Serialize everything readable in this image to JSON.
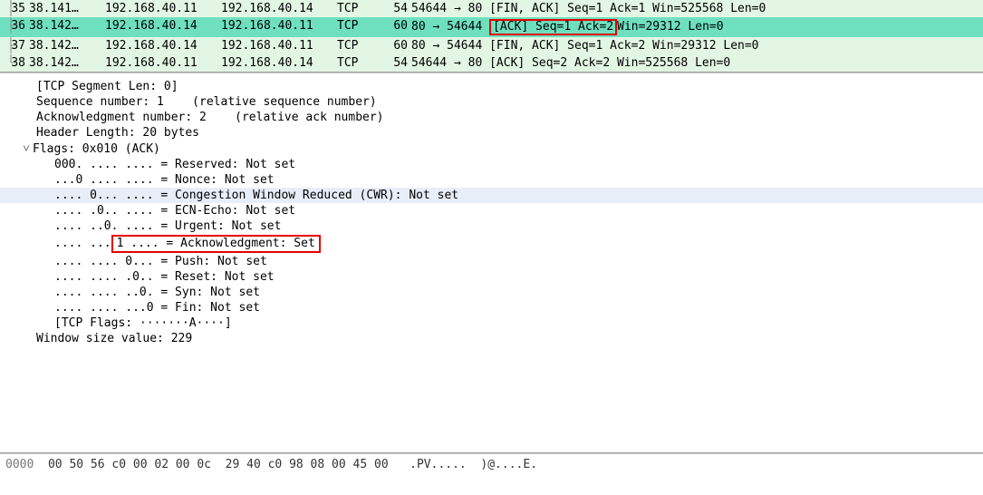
{
  "packets": [
    {
      "no": "35",
      "time": "38.141…",
      "src": "192.168.40.11",
      "dst": "192.168.40.14",
      "proto": "TCP",
      "len": "54",
      "info_pre": "54644 → 80 [FIN, ACK] Seq=1 Ack=1 Win=525568 Len=0",
      "cls": "green",
      "hl_text": "",
      "hl_post": ""
    },
    {
      "no": "36",
      "time": "38.142…",
      "src": "192.168.40.14",
      "dst": "192.168.40.11",
      "proto": "TCP",
      "len": "60",
      "info_pre": "80 → 54644 ",
      "hl_text": "[ACK] Seq=1 Ack=2 ",
      "hl_post": "Win=29312 Len=0",
      "cls": "teal"
    },
    {
      "no": "37",
      "time": "38.142…",
      "src": "192.168.40.14",
      "dst": "192.168.40.11",
      "proto": "TCP",
      "len": "60",
      "info_pre": "80 → 54644 [FIN, ACK] Seq=1 Ack=2 Win=29312 Len=0",
      "cls": "green",
      "hl_text": "",
      "hl_post": ""
    },
    {
      "no": "38",
      "time": "38.142…",
      "src": "192.168.40.11",
      "dst": "192.168.40.14",
      "proto": "TCP",
      "len": "54",
      "info_pre": "54644 → 80 [ACK] Seq=2 Ack=2 Win=525568 Len=0",
      "cls": "green",
      "hl_text": "",
      "hl_post": ""
    }
  ],
  "details": {
    "seg_len": "[TCP Segment Len: 0]",
    "seq": "Sequence number: 1    (relative sequence number)",
    "ackno": "Acknowledgment number: 2    (relative ack number)",
    "hlen": "Header Length: 20 bytes",
    "flags_hdr": "Flags: 0x010 (ACK)",
    "f_reserved": "000. .... .... = Reserved: Not set",
    "f_nonce": "...0 .... .... = Nonce: Not set",
    "f_cwr": ".... 0... .... = Congestion Window Reduced (CWR): Not set",
    "f_ecn": ".... .0.. .... = ECN-Echo: Not set",
    "f_urg": ".... ..0. .... = Urgent: Not set",
    "f_ack_pre": ".... ...",
    "f_ack_box": "1 .... = Acknowledgment: Set",
    "f_push": ".... .... 0... = Push: Not set",
    "f_reset": ".... .... .0.. = Reset: Not set",
    "f_syn": ".... .... ..0. = Syn: Not set",
    "f_fin": ".... .... ...0 = Fin: Not set",
    "f_tcpflags": "[TCP Flags: ·······A····]",
    "winsize": "Window size value: 229"
  },
  "hex": {
    "offset": "0000",
    "bytes": "  00 50 56 c0 00 02 00 0c  29 40 c0 98 08 00 45 00   ",
    "ascii": ".PV.....  )@....E."
  }
}
